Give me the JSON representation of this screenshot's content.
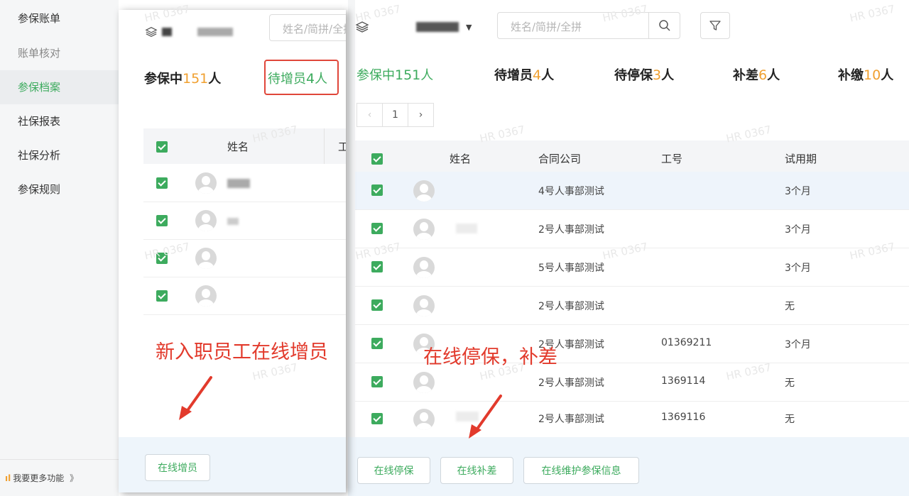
{
  "sidebar": {
    "items": [
      {
        "label": "参保账单"
      },
      {
        "label": "账单核对"
      },
      {
        "label": "参保档案"
      },
      {
        "label": "社保报表"
      },
      {
        "label": "社保分析"
      },
      {
        "label": "参保规则"
      }
    ],
    "footer_label": "我要更多功能",
    "footer_chevron": "》"
  },
  "overlay": {
    "search_placeholder": "姓名/简拼/全拼",
    "stat_active_label": "参保中",
    "stat_active_num": "151",
    "stat_active_unit": "人",
    "stat_pending_label": "待增员",
    "stat_pending_num": "4",
    "stat_pending_unit": "人",
    "col_name": "姓名",
    "col_partial": "工",
    "action_label": "在线增员",
    "annotation": "新入职员工在线增员",
    "row_count": 4
  },
  "main": {
    "search_placeholder": "姓名/简拼/全拼",
    "stats": [
      {
        "label": "参保中",
        "num": "151",
        "unit": "人",
        "green": true
      },
      {
        "label": "待增员",
        "num": "4",
        "unit": "人"
      },
      {
        "label": "待停保",
        "num": "3",
        "unit": "人"
      },
      {
        "label": "补差",
        "num": "6",
        "unit": "人"
      },
      {
        "label": "补缴",
        "num": "10",
        "unit": "人"
      }
    ],
    "pager": {
      "prev": "‹",
      "page": "1",
      "next": "›"
    },
    "columns": {
      "name": "姓名",
      "company": "合同公司",
      "emp_id": "工号",
      "probation": "试用期"
    },
    "rows": [
      {
        "company": "4号人事部测试",
        "emp_id": "",
        "probation": "3个月"
      },
      {
        "company": "2号人事部测试",
        "emp_id": "",
        "probation": "3个月"
      },
      {
        "company": "5号人事部测试",
        "emp_id": "",
        "probation": "3个月"
      },
      {
        "company": "2号人事部测试",
        "emp_id": "",
        "probation": "无"
      },
      {
        "company": "2号人事部测试",
        "emp_id": "01369211",
        "probation": "3个月"
      },
      {
        "company": "2号人事部测试",
        "emp_id": "1369114",
        "probation": "无"
      },
      {
        "company": "2号人事部测试",
        "emp_id": "1369116",
        "probation": "无"
      }
    ],
    "actions": [
      "在线停保",
      "在线补差",
      "在线维护参保信息"
    ],
    "annotation": "在线停保，补差"
  },
  "watermark": "HR 0367",
  "colors": {
    "accent_green": "#3dab5e",
    "count_orange": "#f0a030",
    "annotation_red": "#e23a2c"
  }
}
